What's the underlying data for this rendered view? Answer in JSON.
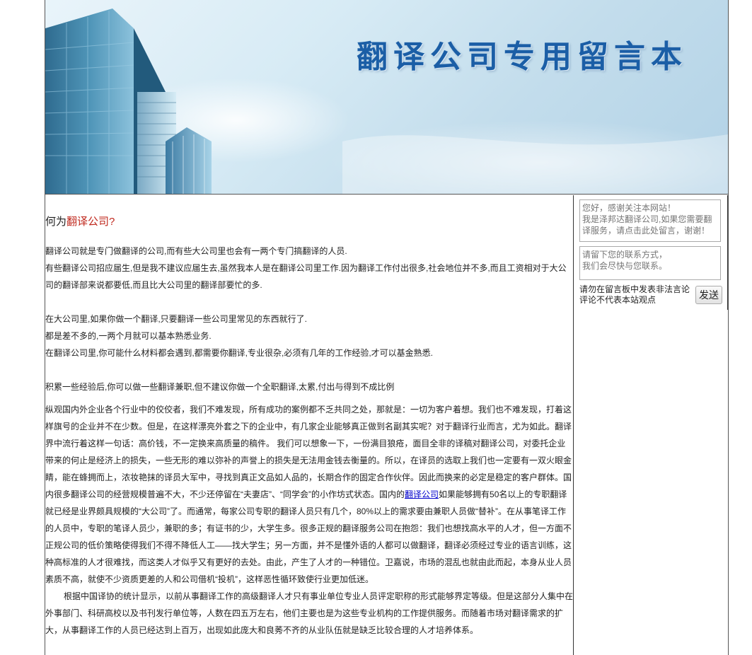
{
  "banner": {
    "title": "翻译公司专用留言本"
  },
  "article": {
    "heading_prefix": "何为",
    "heading_accent": "翻译公司?",
    "para1": "翻译公司就是专门做翻译的公司,而有些大公司里也会有一两个专门搞翻译的人员.",
    "para2": "有些翻译公司招应届生,但是我不建议应届生去,虽然我本人是在翻译公司里工作.因为翻译工作付出很多,社会地位并不多,而且工资相对于大公司的翻译部来说都要低,而且比大公司里的翻译部要忙的多.",
    "para3": "在大公司里,如果你做一个翻译,只要翻译一些公司里常见的东西就行了.",
    "para4": "都是差不多的,一两个月就可以基本熟悉业务.",
    "para5": "在翻译公司里,你可能什么材料都会遇到,都需要你翻译,专业很杂,必须有几年的工作经验,才可以基金熟悉.",
    "para6": "积累一些经验后,你可以做一些翻译兼职,但不建议你做一个全职翻译,太累,付出与得到不成比例",
    "para7a": "纵观国内外企业各个行业中的佼佼者，我们不难发现，所有成功的案例都不乏共同之处，那就是：一切为客户着想。我们也不难发现，打着这样旗号的企业并不在少数。但是，在这样漂亮外套之下的企业中，有几家企业能够真正做到名副其实呢？对于翻译行业而言，尤为如此。翻译界中流行着这样一句话：高价钱，不一定换来高质量的稿件。 我们可以想象一下，一份满目狼疮，面目全非的译稿对翻译公司，对委托企业带来的何止是经济上的损失，一些无形的难以弥补的声誉上的损失是无法用金钱去衡量的。所以，在译员的选取上我们也一定要有一双火眼金睛，能在蜂拥而上，浓妆艳抹的译员大军中，寻找到真正文品如人品的，长期合作的固定合作伙伴。因此而换来的必定是稳定的客户群体。国内很多翻译公司的经营规模普遍不大，不少还停留在“夫妻店”、“同学会”的小作坊式状态。国内的",
    "para7_link": "翻译公司",
    "para7b": "如果能够拥有50名以上的专职翻译就已经是业界颇具规模的“大公司”了。而通常，每家公司专职的翻译人员只有几个，80%以上的需求要由兼职人员做“替补”。在从事笔译工作的人员中，专职的笔译人员少，兼职的多；有证书的少，大学生多。很多正规的翻译服务公司在抱怨：我们也想找高水平的人才，但一方面不正规公司的低价策略使得我们不得不降低人工——找大学生；另一方面，并不是懂外语的人都可以做翻译，翻译必须经过专业的语言训练，这种高标准的人才很难找，而这类人才似乎又有更好的去处。由此，产生了人才的一种错位。卫嘉说，市场的混乱也就由此而起，本身从业人员素质不高，就使不少资质更差的人和公司借机“投机”，这样恶性循环致使行业更加低迷。",
    "para8": "根据中国译协的统计显示，以前从事翻译工作的高级翻译人才只有事业单位专业人员评定职称的形式能够界定等级。但是这部分人集中在外事部门、科研高校以及书刊发行单位等，人数在四五万左右，他们主要也是为这些专业机构的工作提供服务。而随着市场对翻译需求的扩大，从事翻译工作的人员已经达到上百万，出现如此庞大和良莠不齐的从业队伍就是缺乏比较合理的人才培养体系。"
  },
  "guestbook": {
    "message_placeholder": "您好，感谢关注本网站！\n我是泽邦达翻译公司,如果您需要翻译服务，请点击此处留言，谢谢！",
    "contact_placeholder": "请留下您的联系方式，\n我们会尽快与您联系。",
    "notice": "请勿在留言板中发表非法言论评论不代表本站观点",
    "send_label": "发送"
  }
}
